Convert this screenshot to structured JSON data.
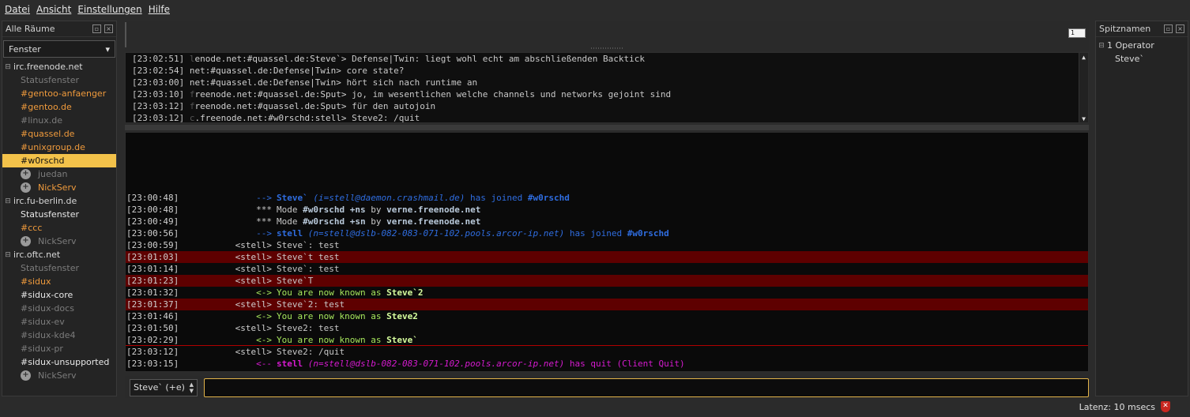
{
  "menu": [
    "Datei",
    "Ansicht",
    "Einstellungen",
    "Hilfe"
  ],
  "rooms_dock": {
    "title": "Alle Räume",
    "filter_value": "Fenster",
    "networks": [
      {
        "name": "irc.freenode.net",
        "items": [
          {
            "label": "Statusfenster",
            "style": "gray"
          },
          {
            "label": "#gentoo-anfaenger",
            "style": "orange"
          },
          {
            "label": "#gentoo.de",
            "style": "orange"
          },
          {
            "label": "#linux.de",
            "style": "gray"
          },
          {
            "label": "#quassel.de",
            "style": "orange"
          },
          {
            "label": "#unixgroup.de",
            "style": "orange"
          },
          {
            "label": "#w0rschd",
            "style": "selected"
          },
          {
            "label": "juedan",
            "style": "gray",
            "nick": true
          },
          {
            "label": "NickServ",
            "style": "orange",
            "nick": true
          }
        ]
      },
      {
        "name": "irc.fu-berlin.de",
        "items": [
          {
            "label": "Statusfenster",
            "style": "white"
          },
          {
            "label": "#ccc",
            "style": "orange"
          },
          {
            "label": "NickServ",
            "style": "gray",
            "nick": true
          }
        ]
      },
      {
        "name": "irc.oftc.net",
        "items": [
          {
            "label": "Statusfenster",
            "style": "gray"
          },
          {
            "label": "#sidux",
            "style": "orange"
          },
          {
            "label": "#sidux-core",
            "style": "white"
          },
          {
            "label": "#sidux-docs",
            "style": "gray"
          },
          {
            "label": "#sidux-ev",
            "style": "gray"
          },
          {
            "label": "#sidux-kde4",
            "style": "gray"
          },
          {
            "label": "#sidux-pr",
            "style": "gray"
          },
          {
            "label": "#sidux-unsupported",
            "style": "white"
          },
          {
            "label": "NickServ",
            "style": "gray",
            "nick": true
          }
        ]
      }
    ]
  },
  "topic_indicator": "1",
  "chatmonitor": [
    {
      "time": "[23:02:51]",
      "prefix": "l",
      "buffer": "enode.net:#quassel.de:Steve`>",
      "text": " Defense|Twin: liegt wohl echt am abschließenden Backtick"
    },
    {
      "time": "[23:02:54]",
      "prefix": "",
      "buffer": "net:#quassel.de:Defense|Twin>",
      "text": " core state?"
    },
    {
      "time": "[23:03:00]",
      "prefix": "",
      "buffer": "net:#quassel.de:Defense|Twin>",
      "text": " hört sich nach runtime an"
    },
    {
      "time": "[23:03:10]",
      "prefix": "f",
      "buffer": "reenode.net:#quassel.de:Sput>",
      "text": " jo, im wesentlichen welche channels und networks gejoint sind"
    },
    {
      "time": "[23:03:12]",
      "prefix": "f",
      "buffer": "reenode.net:#quassel.de:Sput>",
      "text": " für den autojoin"
    },
    {
      "time": "[23:03:12]",
      "prefix": "c",
      "buffer": ".freenode.net:#w0rschd:stell>",
      "text": " Steve2: /quit"
    }
  ],
  "messages": [
    {
      "time": "[23:00:48]",
      "nick": "-->",
      "kind": "join",
      "parts": [
        [
          "blueb",
          "Steve`"
        ],
        [
          "blue",
          " "
        ],
        [
          "bluei",
          "(i=stell@daemon.crashmail.de)"
        ],
        [
          "blue",
          " has joined "
        ],
        [
          "blueb",
          "#w0rschd"
        ]
      ]
    },
    {
      "time": "[23:00:48]",
      "nick": "***",
      "kind": "mode",
      "parts": [
        [
          "grayt",
          "Mode "
        ],
        [
          "modeb",
          "#w0rschd +ns"
        ],
        [
          "grayt",
          " by "
        ],
        [
          "modeb",
          "verne.freenode.net"
        ]
      ]
    },
    {
      "time": "[23:00:49]",
      "nick": "***",
      "kind": "mode",
      "parts": [
        [
          "grayt",
          "Mode "
        ],
        [
          "modeb",
          "#w0rschd +sn"
        ],
        [
          "grayt",
          " by "
        ],
        [
          "modeb",
          "verne.freenode.net"
        ]
      ]
    },
    {
      "time": "[23:00:56]",
      "nick": "-->",
      "kind": "join",
      "parts": [
        [
          "blueb",
          "stell"
        ],
        [
          "blue",
          " "
        ],
        [
          "bluei",
          "(n=stell@dslb-082-083-071-102.pools.arcor-ip.net)"
        ],
        [
          "blue",
          " has joined "
        ],
        [
          "blueb",
          "#w0rschd"
        ]
      ]
    },
    {
      "time": "[23:00:59]",
      "nick": "<stell>",
      "kind": "plain",
      "parts": [
        [
          "grayt",
          "Steve`: test"
        ]
      ]
    },
    {
      "time": "[23:01:03]",
      "nick": "<stell>",
      "kind": "highlight",
      "parts": [
        [
          "grayt",
          "Steve`t test"
        ]
      ]
    },
    {
      "time": "[23:01:14]",
      "nick": "<stell>",
      "kind": "plain",
      "parts": [
        [
          "grayt",
          "Steve`: test"
        ]
      ]
    },
    {
      "time": "[23:01:23]",
      "nick": "<stell>",
      "kind": "highlight",
      "parts": [
        [
          "grayt",
          "Steve`T"
        ]
      ]
    },
    {
      "time": "[23:01:32]",
      "nick": "<->",
      "kind": "nick",
      "parts": [
        [
          "green",
          "You are now known as "
        ],
        [
          "greenb",
          "Steve`2"
        ]
      ]
    },
    {
      "time": "[23:01:37]",
      "nick": "<stell>",
      "kind": "highlight",
      "parts": [
        [
          "grayt",
          "Steve`2: test"
        ]
      ]
    },
    {
      "time": "[23:01:46]",
      "nick": "<->",
      "kind": "nick",
      "parts": [
        [
          "green",
          "You are now known as "
        ],
        [
          "greenb",
          "Steve2"
        ]
      ]
    },
    {
      "time": "[23:01:50]",
      "nick": "<stell>",
      "kind": "plain",
      "parts": [
        [
          "grayt",
          "Steve2: test"
        ]
      ]
    },
    {
      "time": "[23:02:29]",
      "nick": "<->",
      "kind": "nick",
      "parts": [
        [
          "green",
          "You are now known as "
        ],
        [
          "greenb",
          "Steve`"
        ]
      ]
    },
    {
      "time": "[23:03:12]",
      "nick": "<stell>",
      "kind": "plain",
      "parts": [
        [
          "grayt",
          "Steve2: /quit"
        ]
      ]
    },
    {
      "time": "[23:03:15]",
      "nick": "<--",
      "kind": "quit",
      "parts": [
        [
          "magb",
          "stell"
        ],
        [
          "mag",
          " "
        ],
        [
          "magi",
          "(n=stell@dslb-082-083-071-102.pools.arcor-ip.net)"
        ],
        [
          "mag",
          " has quit (Client Quit)"
        ]
      ]
    }
  ],
  "input": {
    "nick": "Steve` (+e)",
    "value": ""
  },
  "nicklist_dock": {
    "title": "Spitznamen",
    "group": "1 Operator",
    "nicks": [
      "Steve`"
    ]
  },
  "status": {
    "latency": "Latenz: 10 msecs"
  },
  "colors": {
    "selected": "#f3c24a",
    "highlight": "#5e0000",
    "join": "#2f6de0",
    "quit": "#d61ad0",
    "nickchange": "#a6e65c",
    "channel_active": "#ef9a3c"
  }
}
